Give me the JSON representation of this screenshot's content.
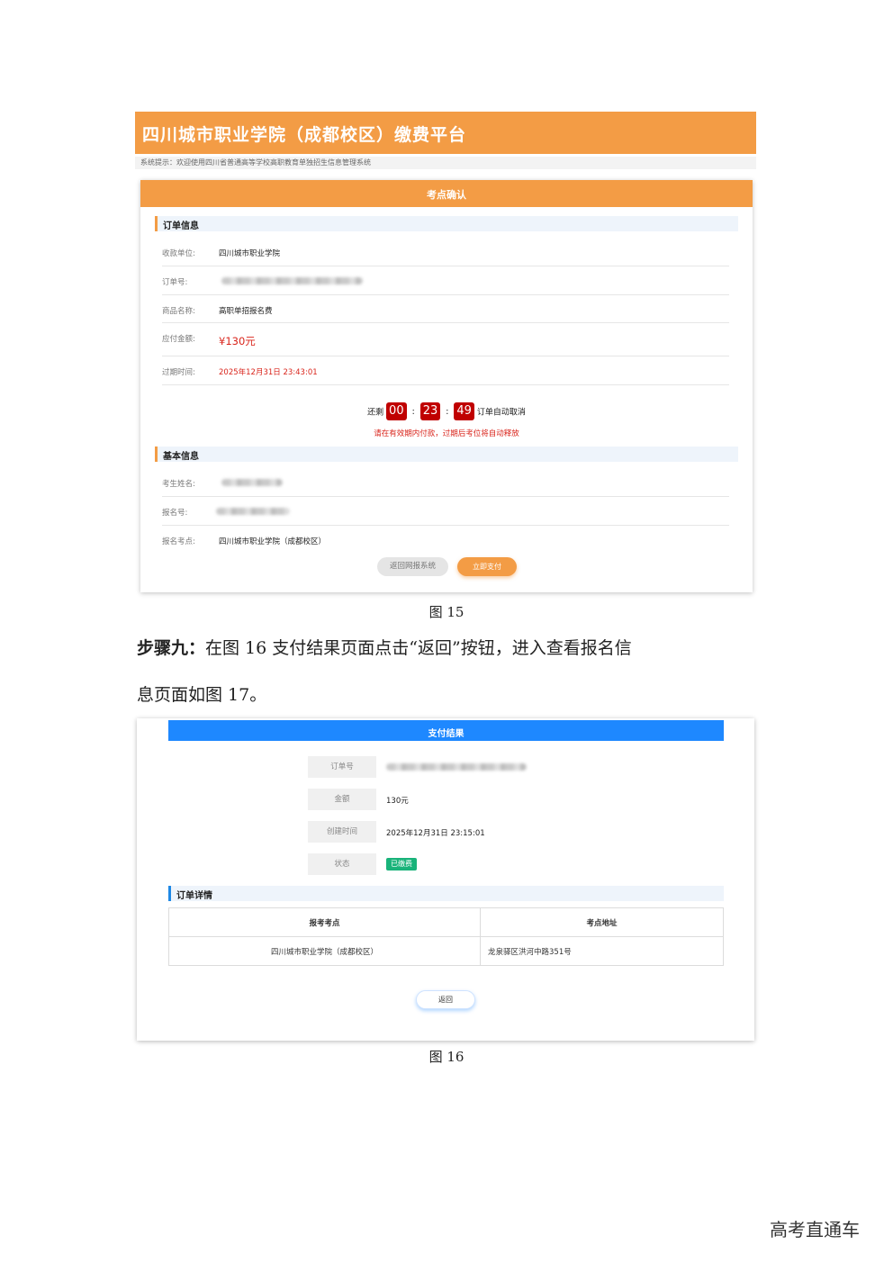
{
  "figure15": {
    "banner_title": "四川城市职业学院（成都校区）缴费平台",
    "notice": "系统提示：欢迎使用四川省普通高等学校高职教育单独招生信息管理系统",
    "card_title": "考点确认",
    "order_section": {
      "title": "订单信息",
      "rows": [
        {
          "label": "收款单位:",
          "value": "四川城市职业学院"
        },
        {
          "label": "订单号:",
          "value": ""
        },
        {
          "label": "商品名称:",
          "value": "高职单招报名费"
        },
        {
          "label": "应付金额:",
          "value": "¥130元"
        },
        {
          "label": "过期时间:",
          "value": "2025年12月31日 23:43:01"
        }
      ]
    },
    "countdown": {
      "prefix": "还剩",
      "hours": "00",
      "minutes": "23",
      "seconds": "49",
      "separator": ":",
      "suffix": "订单自动取消",
      "warning": "请在有效期内付款，过期后考位将自动释放"
    },
    "basic_section": {
      "title": "基本信息",
      "rows": [
        {
          "label": "考生姓名:",
          "value": ""
        },
        {
          "label": "报名号:",
          "value": ""
        },
        {
          "label": "报名考点:",
          "value": "四川城市职业学院（成都校区）"
        }
      ]
    },
    "buttons": {
      "back": "返回网报系统",
      "pay": "立即支付"
    },
    "caption": "图 15"
  },
  "step": {
    "label": "步骤九：",
    "line1": "在图 16 支付结果页面点击“返回”按钮，进入查看报名信",
    "line2": "息页面如图 17。"
  },
  "figure16": {
    "title": "支付结果",
    "fields": [
      {
        "label": "订单号",
        "value": ""
      },
      {
        "label": "金额",
        "value": "130元"
      },
      {
        "label": "创建时间",
        "value": "2025年12月31日 23:15:01"
      },
      {
        "label": "状态",
        "value": "已缴费"
      }
    ],
    "detail_title": "订单详情",
    "table": {
      "headers": [
        "报考考点",
        "考点地址"
      ],
      "rows": [
        [
          "四川城市职业学院（成都校区）",
          "龙泉驿区洪河中路351号"
        ]
      ]
    },
    "return_button": "返回",
    "caption": "图 16"
  },
  "watermark": "高考直通车",
  "colors": {
    "orange": "#f39c45",
    "blue": "#1e88ff",
    "red": "#d9241b",
    "green": "#19b37a"
  }
}
